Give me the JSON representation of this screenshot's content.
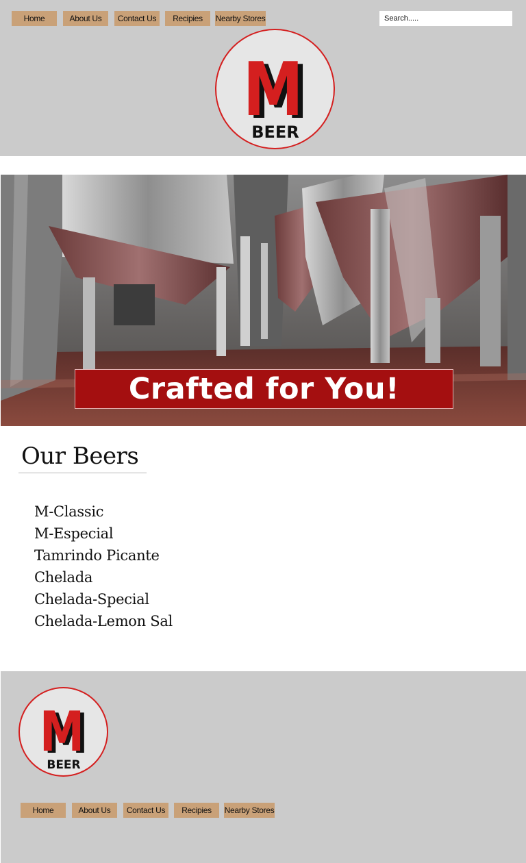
{
  "nav": {
    "items": [
      "Home",
      "About Us",
      "Contact Us",
      "Recipies",
      "Nearby Stores"
    ]
  },
  "search": {
    "placeholder": "Search....."
  },
  "logo": {
    "letter": "M",
    "word": "BEER"
  },
  "hero": {
    "banner_text": "Crafted for You!"
  },
  "beers": {
    "title": "Our Beers",
    "items": [
      "M-Classic",
      "M-Especial",
      "Tamrindo Picante",
      "Chelada",
      "Chelada-Special",
      "Chelada-Lemon Sal"
    ]
  },
  "footer": {
    "nav_items": [
      "Home",
      "About Us",
      "Contact Us",
      "Recipies",
      "Nearby Stores"
    ]
  },
  "colors": {
    "header_bg": "#cbcbcb",
    "nav_button": "#c9a178",
    "logo_red": "#d41f1f",
    "banner_red": "#a40f10"
  }
}
